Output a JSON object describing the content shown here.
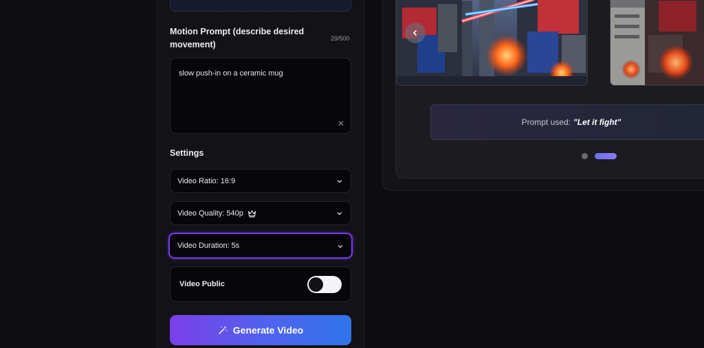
{
  "form": {
    "motion_prompt_label": "Motion Prompt (describe desired movement)",
    "char_count": "29/500",
    "motion_prompt_value": "slow push-in on a ceramic mug",
    "settings_label": "Settings",
    "video_ratio": "Video Ratio: 16:9",
    "video_quality": "Video Quality: 540p",
    "video_duration": "Video Duration: 5s",
    "video_public_label": "Video Public",
    "video_public_on": false,
    "generate_button": "Generate Video"
  },
  "preview": {
    "prompt_used_prefix": "Prompt used:",
    "prompt_used_value": "\"Let it fight\"",
    "carousel_active_index": 1,
    "carousel_count": 2
  },
  "icons": {
    "select_chevron": "chevron-down-icon",
    "quality_badge": "crown-icon",
    "clear": "close-icon",
    "generate": "magic-wand-icon",
    "carousel_prev": "chevron-left-icon"
  },
  "colors": {
    "accent_purple": "#7c3aed",
    "button_gradient_start": "#7b3fe9",
    "button_gradient_end": "#2f74ea",
    "active_dot": "#6d6ff0"
  }
}
